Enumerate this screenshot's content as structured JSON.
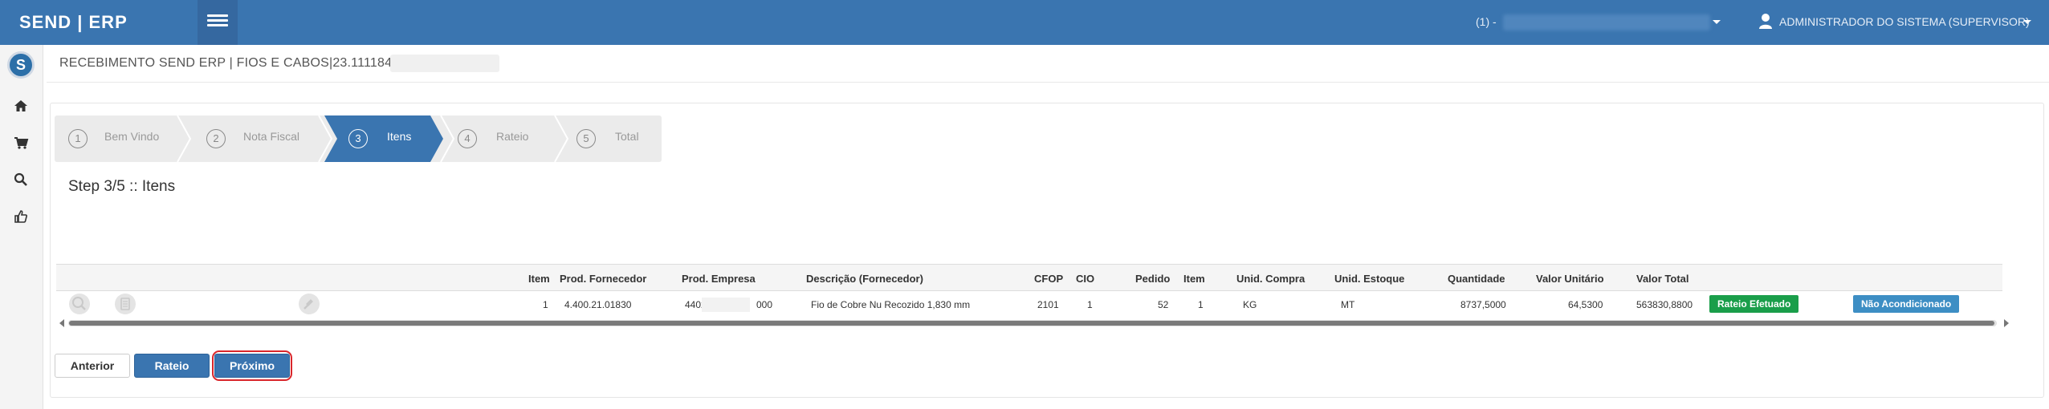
{
  "topbar": {
    "brand": "SEND | ERP",
    "company_label": "(1) -",
    "user_label": "ADMINISTRADOR DO SISTEMA (SUPERVISOR)"
  },
  "page": {
    "title": "RECEBIMENTO SEND ERP | FIOS E CABOS|23.111184|"
  },
  "wizard": {
    "steps": [
      {
        "num": "1",
        "label": "Bem Vindo"
      },
      {
        "num": "2",
        "label": "Nota Fiscal"
      },
      {
        "num": "3",
        "label": "Itens"
      },
      {
        "num": "4",
        "label": "Rateio"
      },
      {
        "num": "5",
        "label": "Total"
      }
    ],
    "active_step": 3,
    "heading": "Step 3/5 :: Itens"
  },
  "table": {
    "headers": {
      "item": "Item",
      "prod_fornecedor": "Prod. Fornecedor",
      "prod_empresa": "Prod. Empresa",
      "descricao": "Descrição (Fornecedor)",
      "cfop": "CFOP",
      "cio": "CIO",
      "pedido": "Pedido",
      "item2": "Item",
      "unid_compra": "Unid. Compra",
      "unid_estoque": "Unid. Estoque",
      "quantidade": "Quantidade",
      "valor_unitario": "Valor Unitário",
      "valor_total": "Valor Total"
    },
    "rows": [
      {
        "item": "1",
        "prod_fornecedor": "4.400.21.01830",
        "prod_empresa_start": "4402",
        "prod_empresa_end": "000",
        "descricao": "Fio de Cobre Nu Recozido 1,830 mm",
        "cfop": "2101",
        "cio": "1",
        "pedido": "52",
        "item2": "1",
        "unid_compra": "KG",
        "unid_estoque": "MT",
        "quantidade": "8737,5000",
        "valor_unitario": "64,5300",
        "valor_total": "563830,8800",
        "badge_rateio": "Rateio Efetuado",
        "badge_acond": "Não Acondicionado"
      }
    ]
  },
  "buttons": {
    "anterior": "Anterior",
    "rateio": "Rateio",
    "proximo": "Próximo"
  },
  "colors": {
    "primary": "#3a75b0",
    "success": "#1a9e4a",
    "info": "#3d8ec4",
    "highlight": "#d9262b"
  }
}
